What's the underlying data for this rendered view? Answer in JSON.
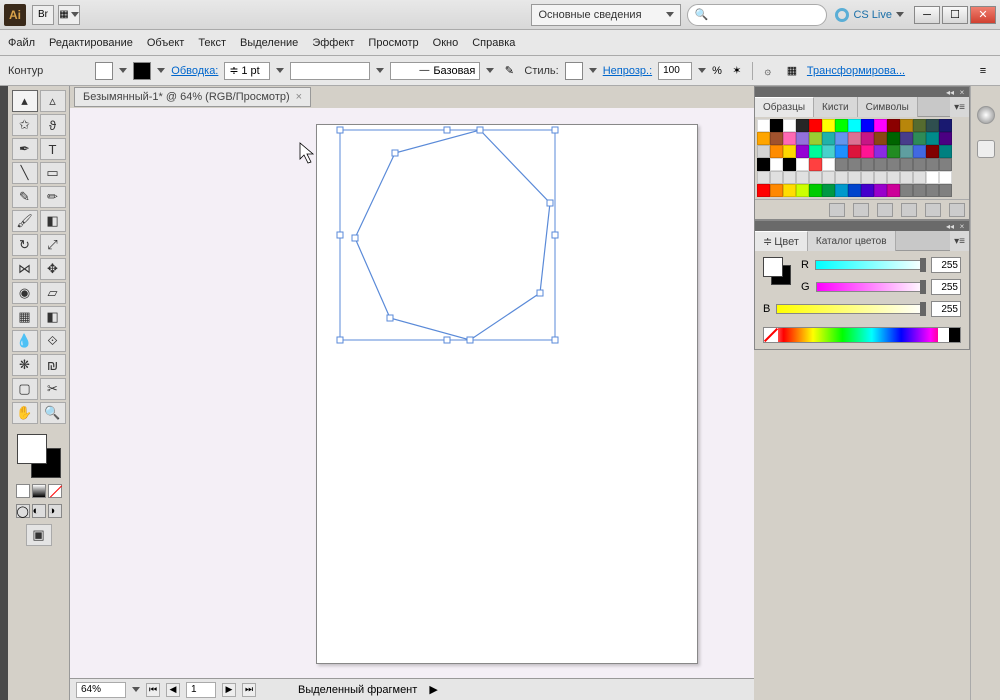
{
  "app": {
    "logo": "Ai",
    "br": "Br"
  },
  "titlebar": {
    "workspace_dd": "Основные сведения",
    "cslive": "CS Live"
  },
  "menu": [
    "Файл",
    "Редактирование",
    "Объект",
    "Текст",
    "Выделение",
    "Эффект",
    "Просмотр",
    "Окно",
    "Справка"
  ],
  "controlbar": {
    "label": "Контур",
    "stroke_label": "Обводка:",
    "stroke_value": "1 pt",
    "brush_label": "Базовая",
    "style_label": "Стиль:",
    "opacity_label": "Непрозр.:",
    "opacity_value": "100",
    "opacity_pct": "%",
    "transform": "Трансформирова..."
  },
  "document": {
    "tab": "Безымянный-1* @ 64% (RGB/Просмотр)"
  },
  "status": {
    "zoom": "64%",
    "page": "1",
    "info": "Выделенный фрагмент"
  },
  "panels": {
    "swatches": {
      "tabs": [
        "Образцы",
        "Кисти",
        "Символы"
      ]
    },
    "color": {
      "tabs": [
        "Цвет",
        "Каталог цветов"
      ],
      "channels": [
        {
          "label": "R",
          "value": "255",
          "grad": "linear-gradient(90deg,#00ffff,#ffffff)"
        },
        {
          "label": "G",
          "value": "255",
          "grad": "linear-gradient(90deg,#ff00ff,#ffffff)"
        },
        {
          "label": "B",
          "value": "255",
          "grad": "linear-gradient(90deg,#ffff00,#ffffff)"
        }
      ]
    }
  },
  "swatches_rows": [
    [
      "#ffffff",
      "#000000",
      "#ffffff",
      "#262626",
      "#ff0000",
      "#ffff00",
      "#00ff00",
      "#00ffff",
      "#0000ff",
      "#ff00ff",
      "#8b0000",
      "#b8860b",
      "#556b2f",
      "#2f4f4f",
      "#191970"
    ],
    [
      "#ffa500",
      "#a0522d",
      "#ff69b4",
      "#9370db",
      "#9acd32",
      "#20b2aa",
      "#6495ed",
      "#db7093",
      "#c71585",
      "#8b4513",
      "#006400",
      "#483d8b",
      "#2e8b57",
      "#008b8b",
      "#4b0082"
    ],
    [
      "#d3d3d3",
      "#ff8c00",
      "#ffd700",
      "#9400d3",
      "#00fa9a",
      "#48d1cc",
      "#1e90ff",
      "#dc143c",
      "#ff1493",
      "#8a2be2",
      "#228b22",
      "#5f9ea0",
      "#4169e1",
      "#800000",
      "#008080"
    ],
    [
      "#000000",
      "#ffffff",
      "#000000",
      "#ffffff",
      "#ff4040",
      "#ffffff",
      "#808080",
      "#808080",
      "#808080",
      "#808080",
      "#808080",
      "#808080",
      "#808080",
      "#808080",
      "#808080"
    ],
    [
      "#e0e0e0",
      "#e0e0e0",
      "#e0e0e0",
      "#e0e0e0",
      "#e0e0e0",
      "#e0e0e0",
      "#e0e0e0",
      "#e0e0e0",
      "#e0e0e0",
      "#e0e0e0",
      "#e0e0e0",
      "#e0e0e0",
      "#e0e0e0",
      "#ffffff",
      "#ffffff"
    ],
    [
      "#ff0000",
      "#ff8800",
      "#ffdd00",
      "#ccff00",
      "#00cc00",
      "#009944",
      "#0099cc",
      "#0044cc",
      "#4400cc",
      "#9900cc",
      "#cc0099",
      "#808080",
      "#808080",
      "#808080",
      "#808080"
    ]
  ]
}
